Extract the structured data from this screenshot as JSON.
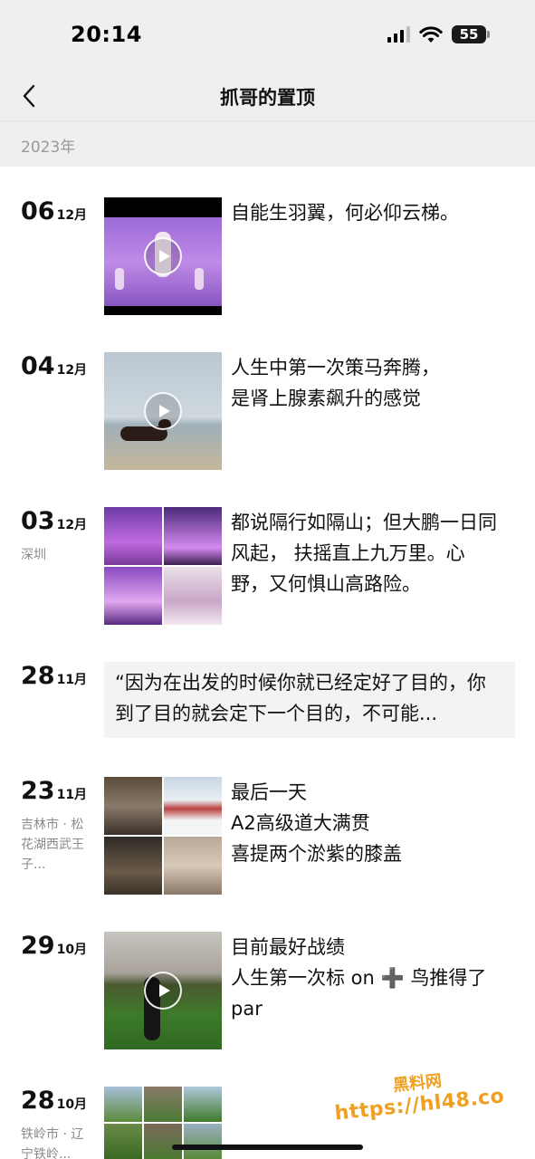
{
  "status_bar": {
    "time": "20:14",
    "battery": "55"
  },
  "nav": {
    "title": "抓哥的置顶"
  },
  "year": "2023年",
  "posts": [
    {
      "day": "06",
      "month": "12月",
      "location": "",
      "caption": "自能生羽翼，何必仰云梯。",
      "media": "video"
    },
    {
      "day": "04",
      "month": "12月",
      "location": "",
      "caption": "人生中第一次策马奔腾，\n是肾上腺素飙升的感觉",
      "media": "video"
    },
    {
      "day": "03",
      "month": "12月",
      "location": "深圳",
      "caption": "都说隔行如隔山；但大鹏一日同风起， 扶摇直上九万里。心野，又何惧山高路险。",
      "media": "grid4"
    },
    {
      "day": "28",
      "month": "11月",
      "location": "",
      "quote": "“因为在出发的时候你就已经定好了目的，你到了目的就会定下一个目的，不可能...",
      "media": "text"
    },
    {
      "day": "23",
      "month": "11月",
      "location": "吉林市 · 松花湖西武王子...",
      "caption": "最后一天\nA2高级道大满贯\n喜提两个淤紫的膝盖",
      "media": "grid4"
    },
    {
      "day": "29",
      "month": "10月",
      "location": "",
      "caption": "目前最好战绩\n人生第一次标 on ➕ 鸟推得了par",
      "media": "video"
    },
    {
      "day": "28",
      "month": "10月",
      "location": "铁岭市 · 辽宁铁岭...",
      "caption": "",
      "media": "grid9"
    }
  ],
  "watermark": {
    "top": "黑料网",
    "url": "https://hl48.co"
  },
  "colors": {
    "nav_bg": "#efefef",
    "text": "#111111",
    "secondary": "#8a8a8a",
    "quote_bg": "#f3f3f3",
    "watermark": "#f0a020"
  }
}
